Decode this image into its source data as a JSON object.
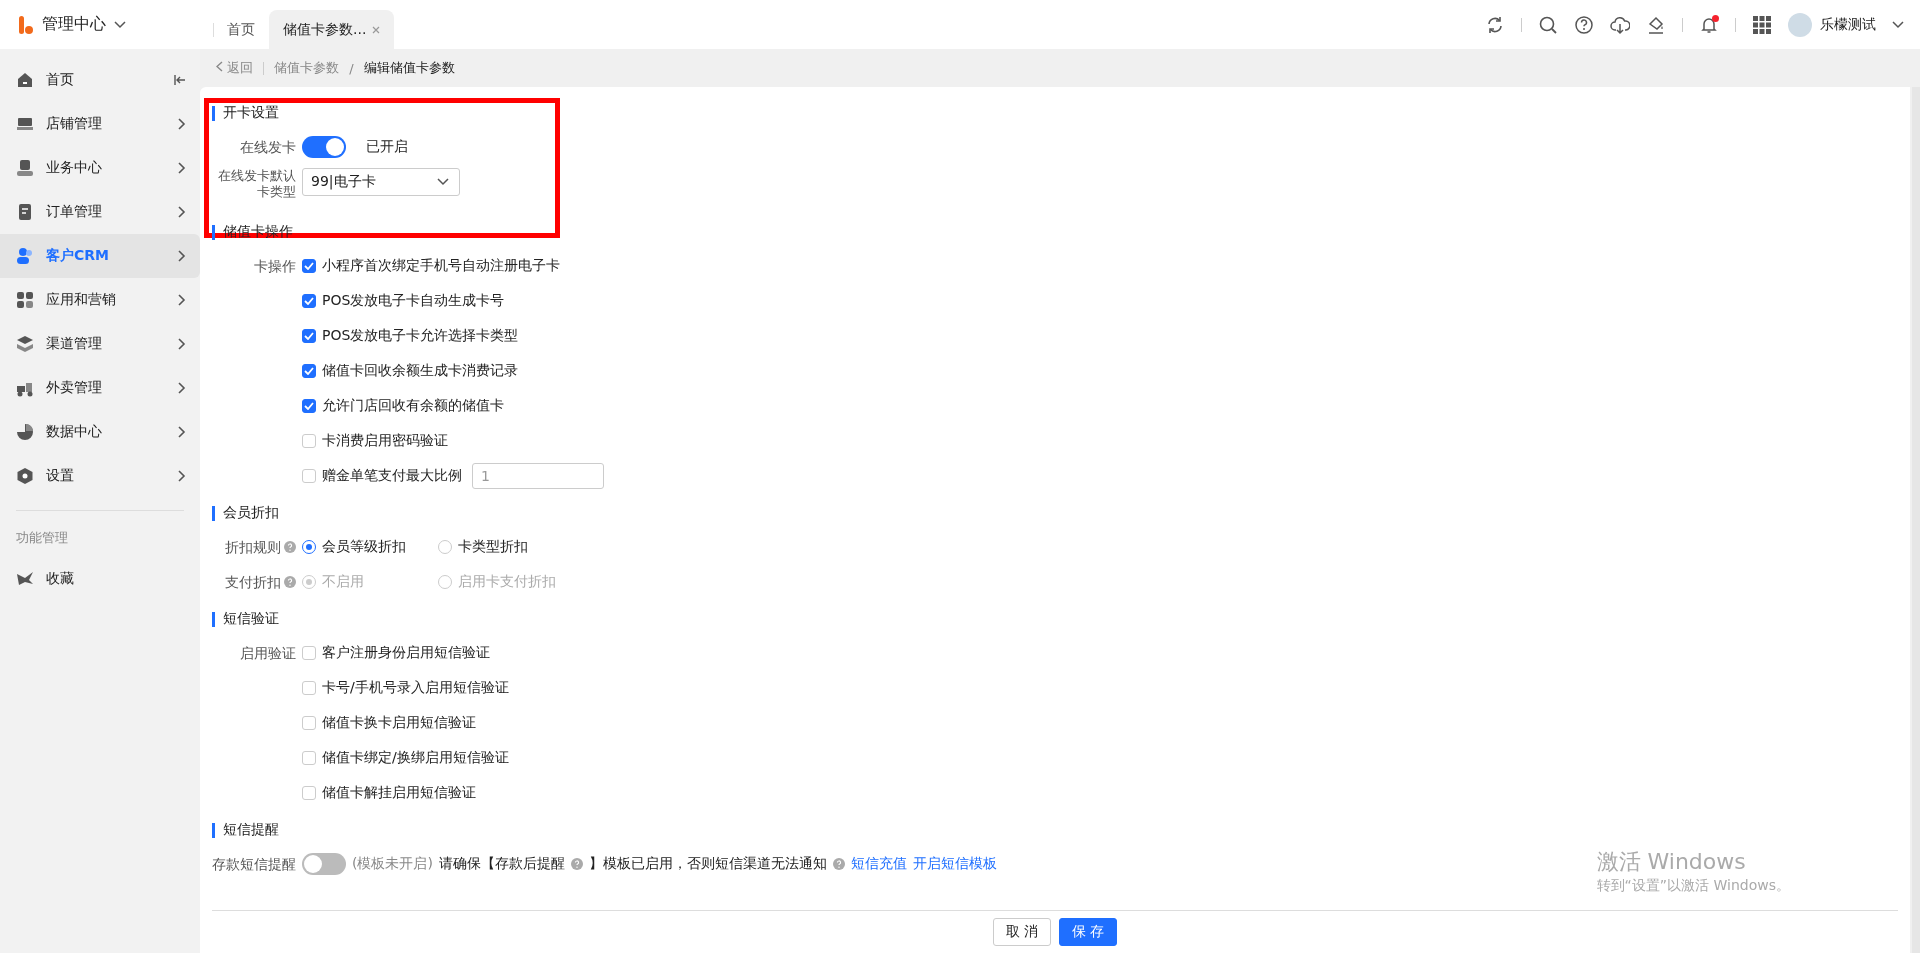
{
  "header": {
    "app_title": "管理中心",
    "tabs": [
      {
        "label": "首页",
        "selected": false,
        "closable": false
      },
      {
        "label": "储值卡参数...",
        "selected": true,
        "closable": true
      }
    ],
    "has_notification": true,
    "user_name": "乐檬测试"
  },
  "sidebar": {
    "items": [
      {
        "label": "首页",
        "selected": false,
        "kind": "collapse"
      },
      {
        "label": "店铺管理",
        "selected": false,
        "kind": "menu"
      },
      {
        "label": "业务中心",
        "selected": false,
        "kind": "menu"
      },
      {
        "label": "订单管理",
        "selected": false,
        "kind": "menu"
      },
      {
        "label": "客户CRM",
        "selected": true,
        "kind": "menu"
      },
      {
        "label": "应用和营销",
        "selected": false,
        "kind": "menu"
      },
      {
        "label": "渠道管理",
        "selected": false,
        "kind": "menu"
      },
      {
        "label": "外卖管理",
        "selected": false,
        "kind": "menu"
      },
      {
        "label": "数据中心",
        "selected": false,
        "kind": "menu"
      },
      {
        "label": "设置",
        "selected": false,
        "kind": "menu"
      }
    ],
    "section_label": "功能管理",
    "favorites": {
      "label": "收藏"
    }
  },
  "breadcrumb": {
    "back": "返回",
    "items": [
      "储值卡参数",
      "编辑储值卡参数"
    ],
    "separator": "/"
  },
  "sections": [
    {
      "title": "开卡设置",
      "highlighted": true,
      "rows": [
        {
          "kind": "switch",
          "label": "在线发卡",
          "on": true,
          "status": "已开启"
        },
        {
          "kind": "select",
          "label": "在线发卡默认卡类型",
          "value": "99|电子卡"
        }
      ]
    },
    {
      "title": "储值卡操作",
      "highlighted": false,
      "rows": [
        {
          "kind": "checkboxes",
          "label": "卡操作",
          "options": [
            {
              "label": "小程序首次绑定手机号自动注册电子卡",
              "checked": true
            },
            {
              "label": "POS发放电子卡自动生成卡号",
              "checked": true
            },
            {
              "label": "POS发放电子卡允许选择卡类型",
              "checked": true
            },
            {
              "label": "储值卡回收余额生成卡消费记录",
              "checked": true
            },
            {
              "label": "允许门店回收有余额的储值卡",
              "checked": true
            },
            {
              "label": "卡消费启用密码验证",
              "checked": false
            },
            {
              "label": "赠金单笔支付最大比例",
              "checked": false,
              "input_value": "1"
            }
          ]
        }
      ]
    },
    {
      "title": "会员折扣",
      "highlighted": false,
      "rows": [
        {
          "kind": "radios",
          "label": "折扣规则",
          "disabled": false,
          "options": [
            {
              "label": "会员等级折扣",
              "selected": true
            },
            {
              "label": "卡类型折扣",
              "selected": false
            }
          ]
        },
        {
          "kind": "radios",
          "label": "支付折扣",
          "disabled": true,
          "options": [
            {
              "label": "不启用",
              "selected": true
            },
            {
              "label": "启用卡支付折扣",
              "selected": false
            }
          ]
        }
      ]
    },
    {
      "title": "短信验证",
      "highlighted": false,
      "rows": [
        {
          "kind": "checkboxes",
          "label": "启用验证",
          "options": [
            {
              "label": "客户注册身份启用短信验证",
              "checked": false
            },
            {
              "label": "卡号/手机号录入启用短信验证",
              "checked": false
            },
            {
              "label": "储值卡换卡启用短信验证",
              "checked": false
            },
            {
              "label": "储值卡绑定/换绑启用短信验证",
              "checked": false
            },
            {
              "label": "储值卡解挂启用短信验证",
              "checked": false
            }
          ]
        }
      ]
    },
    {
      "title": "短信提醒",
      "highlighted": false,
      "rows": [
        {
          "kind": "switch",
          "label": "存款短信提醒",
          "on": false,
          "status": "(模板未开启)",
          "notice": [
            "请确保【存款后提醒",
            "】模板已启用，否则短信渠道无法通知"
          ],
          "links": [
            "短信充值",
            "开启短信模板"
          ]
        }
      ]
    }
  ],
  "footer": {
    "buttons": [
      {
        "label": "取 消",
        "kind": "secondary"
      },
      {
        "label": "保 存",
        "kind": "primary"
      }
    ]
  },
  "os_notice": {
    "title": "激活 Windows",
    "subtitle": "转到“设置”以激活 Windows。"
  }
}
